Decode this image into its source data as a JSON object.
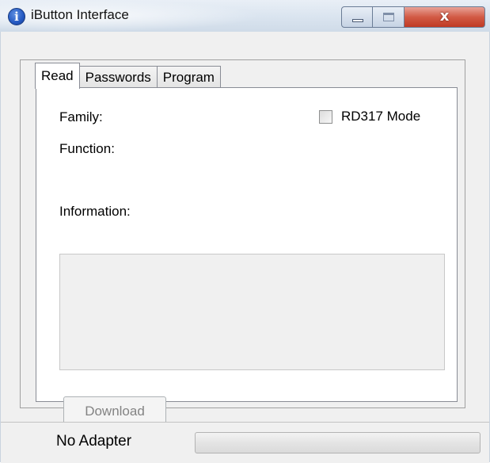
{
  "window": {
    "title": "iButton Interface",
    "icon": "info-icon",
    "icon_glyph": "i",
    "caption": {
      "minimize_icon": "minimize-icon",
      "maximize_icon": "maximize-icon",
      "close_icon": "close-icon",
      "close_glyph": "x"
    }
  },
  "tabs": [
    {
      "label": "Read",
      "active": true
    },
    {
      "label": "Passwords",
      "active": false
    },
    {
      "label": "Program",
      "active": false
    }
  ],
  "read": {
    "family_label": "Family:",
    "function_label": "Function:",
    "rd317_label": "RD317 Mode",
    "rd317_checked": false,
    "information_label": "Information:",
    "information_value": "",
    "download_label": "Download",
    "download_enabled": false
  },
  "status": {
    "text": "No Adapter",
    "progress": 0
  },
  "colors": {
    "close_button": "#c9452f",
    "title_bar": "#dbe5f0",
    "window_bg": "#f0f0f0"
  }
}
